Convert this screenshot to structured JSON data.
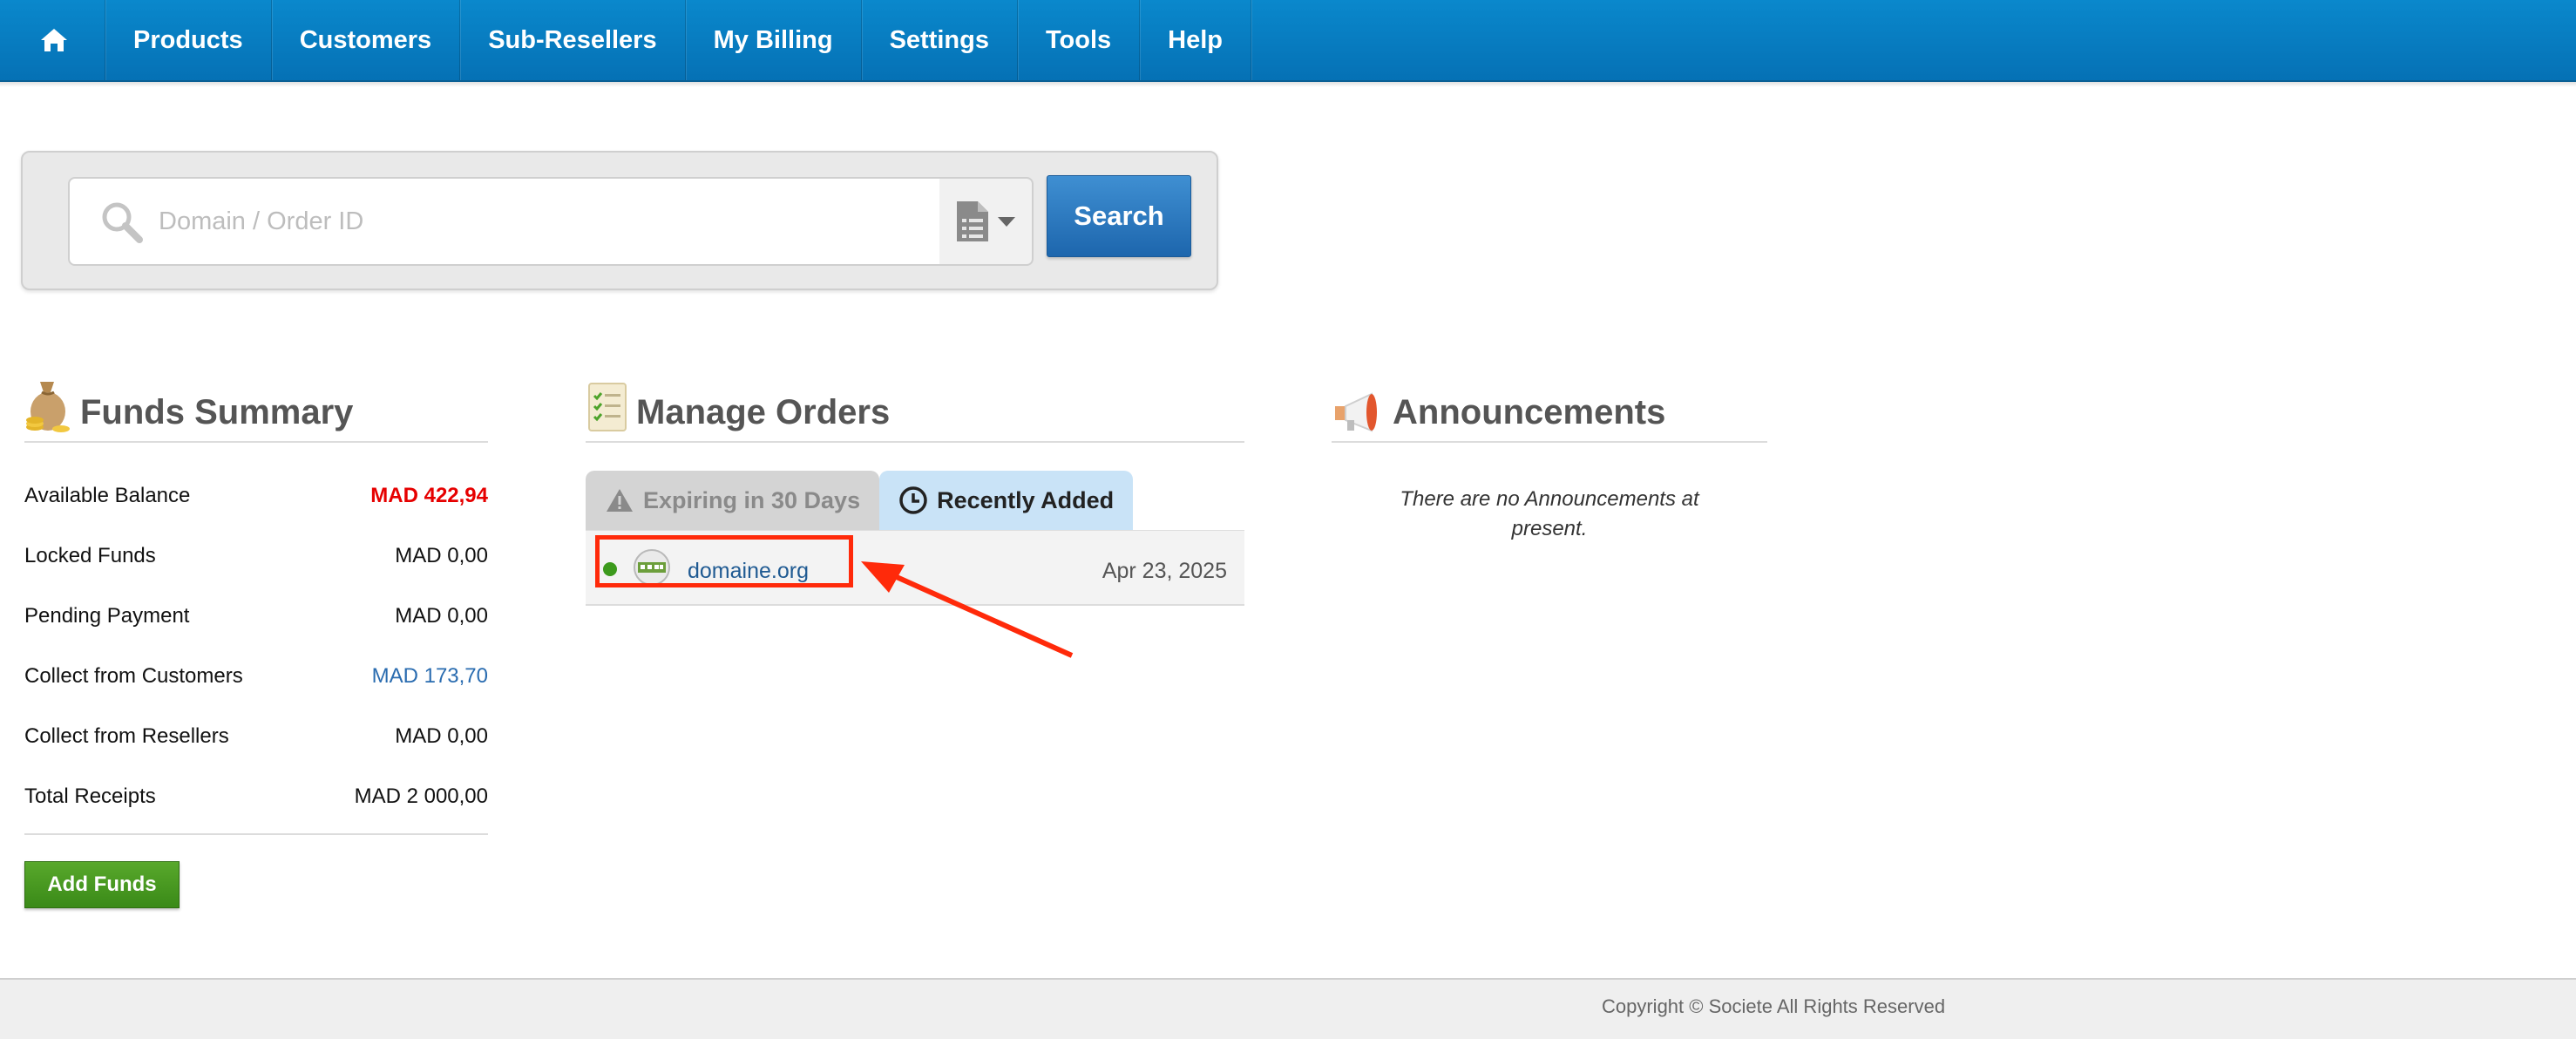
{
  "nav": {
    "home_icon": "home-icon",
    "items": [
      {
        "label": "Products"
      },
      {
        "label": "Customers"
      },
      {
        "label": "Sub-Resellers"
      },
      {
        "label": "My Billing"
      },
      {
        "label": "Settings"
      },
      {
        "label": "Tools"
      },
      {
        "label": "Help"
      }
    ]
  },
  "search": {
    "placeholder": "Domain / Order ID",
    "value": "",
    "button_label": "Search",
    "type_icon": "document-list-icon"
  },
  "funds": {
    "title": "Funds Summary",
    "icon": "money-bag-icon",
    "rows": [
      {
        "label": "Available Balance",
        "value": "MAD 422,94"
      },
      {
        "label": "Locked Funds",
        "value": "MAD 0,00"
      },
      {
        "label": "Pending Payment",
        "value": "MAD 0,00"
      },
      {
        "label": "Collect from Customers",
        "value": "MAD 173,70"
      },
      {
        "label": "Collect from Resellers",
        "value": "MAD 0,00"
      },
      {
        "label": "Total Receipts",
        "value": "MAD 2 000,00"
      }
    ],
    "add_button": "Add Funds"
  },
  "orders": {
    "title": "Manage Orders",
    "icon": "orders-checklist-icon",
    "tabs": [
      {
        "label": "Expiring in 30 Days",
        "icon": "warning-icon",
        "active": false
      },
      {
        "label": "Recently Added",
        "icon": "clock-icon",
        "active": true
      }
    ],
    "rows": [
      {
        "status": "active",
        "domain": "domaine.org",
        "date": "Apr 23, 2025"
      }
    ]
  },
  "announcements": {
    "title": "Announcements",
    "icon": "megaphone-icon",
    "empty_text": "There are no Announcements at present."
  },
  "footer": {
    "copyright": "Copyright © Societe All Rights Reserved"
  },
  "colors": {
    "nav": "#0a88cc",
    "accent_button": "#1d66ad",
    "add_funds": "#3a8a18",
    "balance_red": "#e60000",
    "link_blue": "#2a6cb0",
    "highlight": "#ff2a0a"
  }
}
